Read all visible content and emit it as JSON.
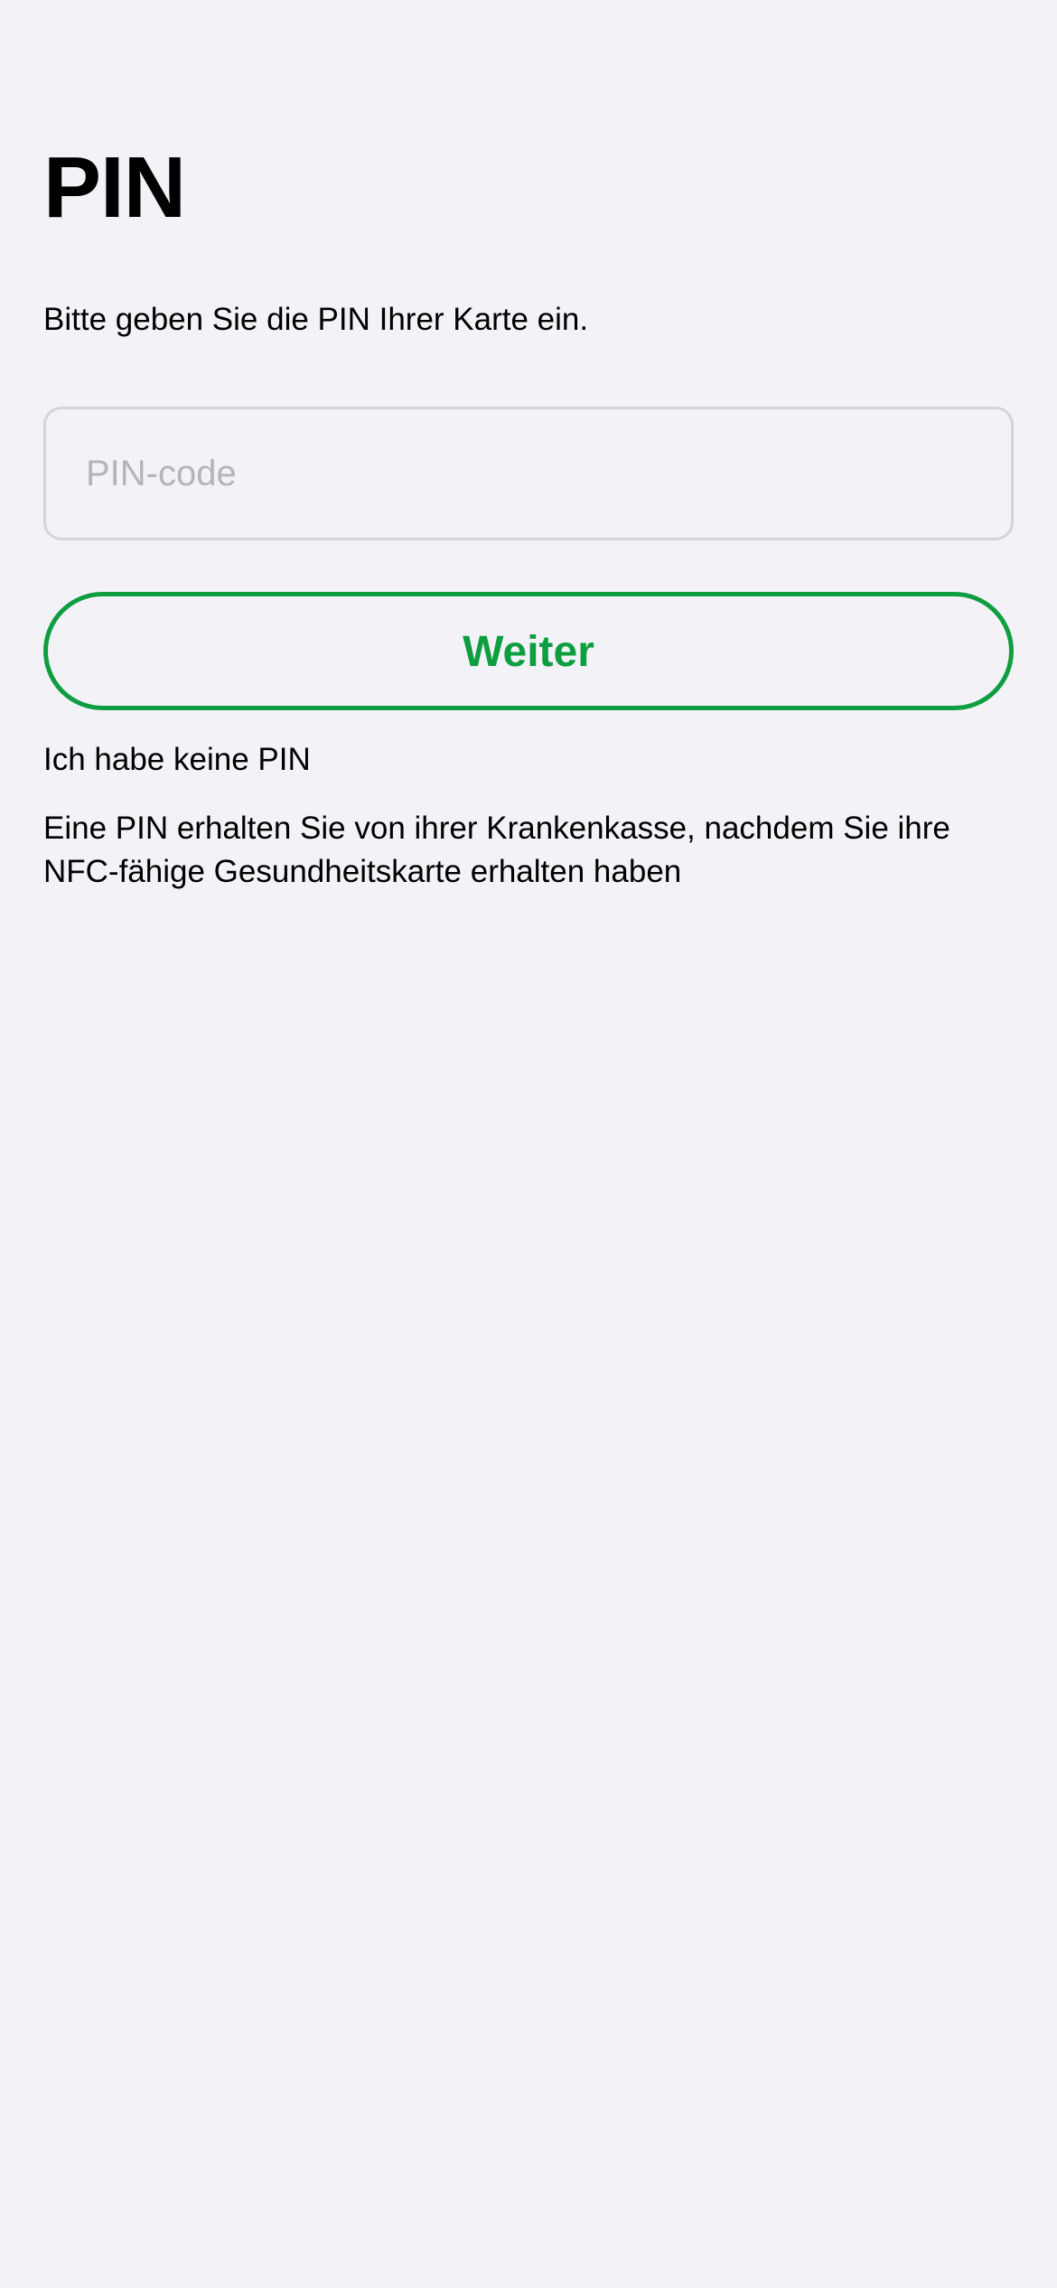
{
  "screen": {
    "title": "PIN",
    "instruction": "Bitte geben Sie die PIN Ihrer Karte ein.",
    "pin_input": {
      "placeholder": "PIN-code",
      "value": ""
    },
    "continue_label": "Weiter",
    "no_pin_label": "Ich habe keine PIN",
    "info_text": "Eine PIN erhalten Sie von ihrer Krankenkasse, nachdem Sie ihre NFC-fähige Gesundheitskarte erhalten haben"
  },
  "colors": {
    "background": "#F2F2F7",
    "accent": "#0E9E3F",
    "placeholder": "#B4B4BA",
    "field_border": "#D4D4D9"
  }
}
